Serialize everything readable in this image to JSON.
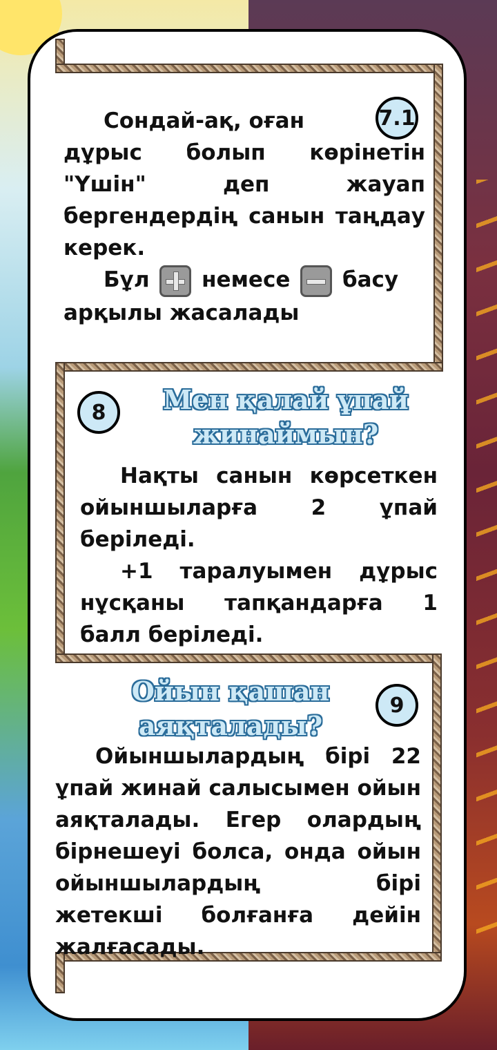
{
  "section1": {
    "badge": "7.1",
    "line1": "Сондай-ақ, оған",
    "rest": "дұрыс болып көрінетін \"Үшін\" деп жауап бергендердің санын таңдау керек.",
    "line_b_pre": "Бұл",
    "line_b_mid": "немесе",
    "line_b_post": "басу арқылы жасалады",
    "plus_icon": "plus-button-icon",
    "minus_icon": "minus-button-icon"
  },
  "section2": {
    "badge": "8",
    "heading": "Мен қалай ұпай жинаймын?",
    "para1": "Нақты санын көрсеткен ойыншыларға 2 ұпай беріледі.",
    "para2": "+1 таралуымен дұрыс нұсқаны тапқандарға 1 балл беріледі."
  },
  "section3": {
    "badge": "9",
    "heading": "Ойын қашан аяқталады?",
    "para": "Ойыншылардың бірі 22 ұпай жинай салысымен ойын аяқталады. Егер олардың бірнешеуі болса, онда ойын ойыншылардың бірі жетекші болғанға дейін жалғасады."
  }
}
